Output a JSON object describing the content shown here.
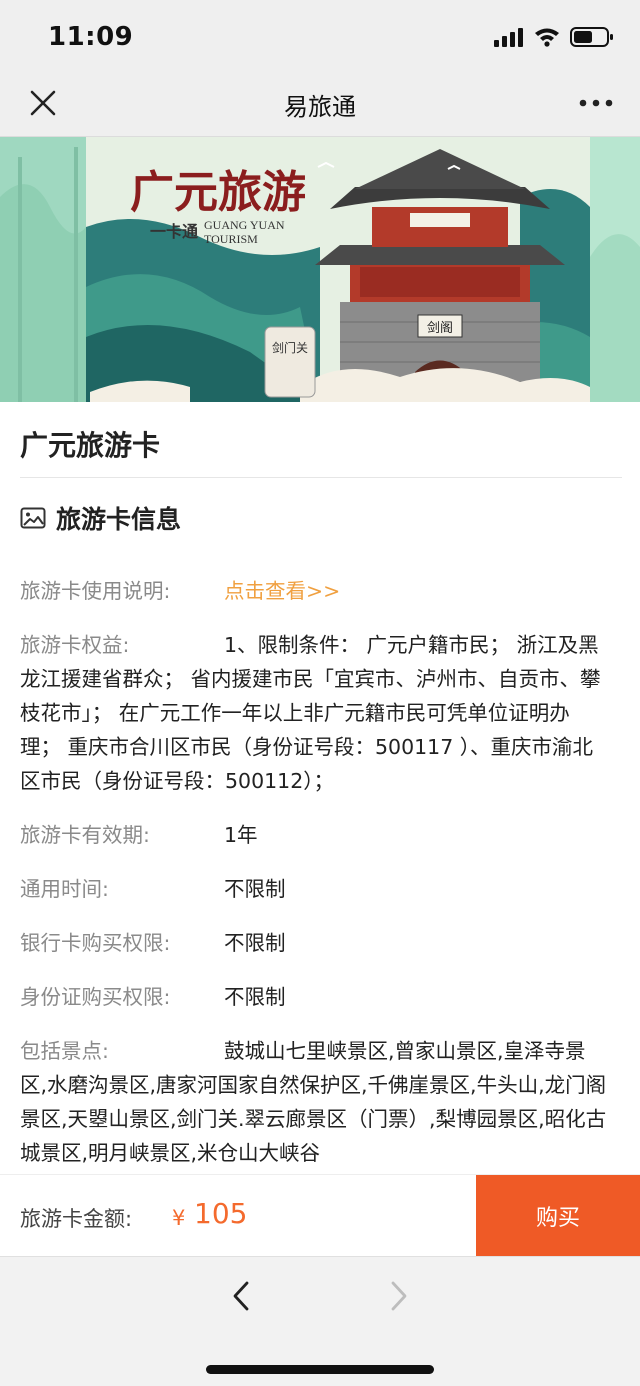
{
  "status_bar": {
    "time": "11:09"
  },
  "nav": {
    "title": "易旅通"
  },
  "banner": {
    "title": "广元旅游",
    "subtitle_cn": "一卡通",
    "subtitle_en_1": "GUANG YUAN",
    "subtitle_en_2": "TOURISM",
    "gate_label_1": "剑门关",
    "gate_label_2": "剑阁"
  },
  "card": {
    "title": "广元旅游卡"
  },
  "section": {
    "label": "旅游卡信息",
    "icon": "image-icon"
  },
  "details": {
    "usage_key": "旅游卡使用说明:",
    "usage_link": "点击查看>>",
    "rights_key": "旅游卡权益:",
    "rights_value": "1、限制条件：  广元户籍市民；  浙江及黑龙江援建省群众；  省内援建市民「宜宾市、泸州市、自贡市、攀枝花市」；  在广元工作一年以上非广元籍市民可凭单位证明办理；  重庆市合川区市民（身份证号段：500117 ）、重庆市渝北区市民（身份证号段：500112）；",
    "validity_key": "旅游卡有效期:",
    "validity_value": "1年",
    "time_key": "通用时间:",
    "time_value": "不限制",
    "bank_key": "银行卡购买权限:",
    "bank_value": "不限制",
    "id_key": "身份证购买权限:",
    "id_value": "不限制",
    "spots_key": "包括景点:",
    "spots_value": "鼓城山七里峡景区,曾家山景区,皇泽寺景区,水磨沟景区,唐家河国家自然保护区,千佛崖景区,牛头山,龙门阁景区,天曌山景区,剑门关.翠云廊景区（门票）,梨博园景区,昭化古城景区,明月峡景区,米仓山大峡谷"
  },
  "purchase": {
    "price_label": "旅游卡金额:",
    "currency": "¥",
    "price": "105",
    "buy_label": "购买",
    "accent_color": "#ef5a26"
  }
}
